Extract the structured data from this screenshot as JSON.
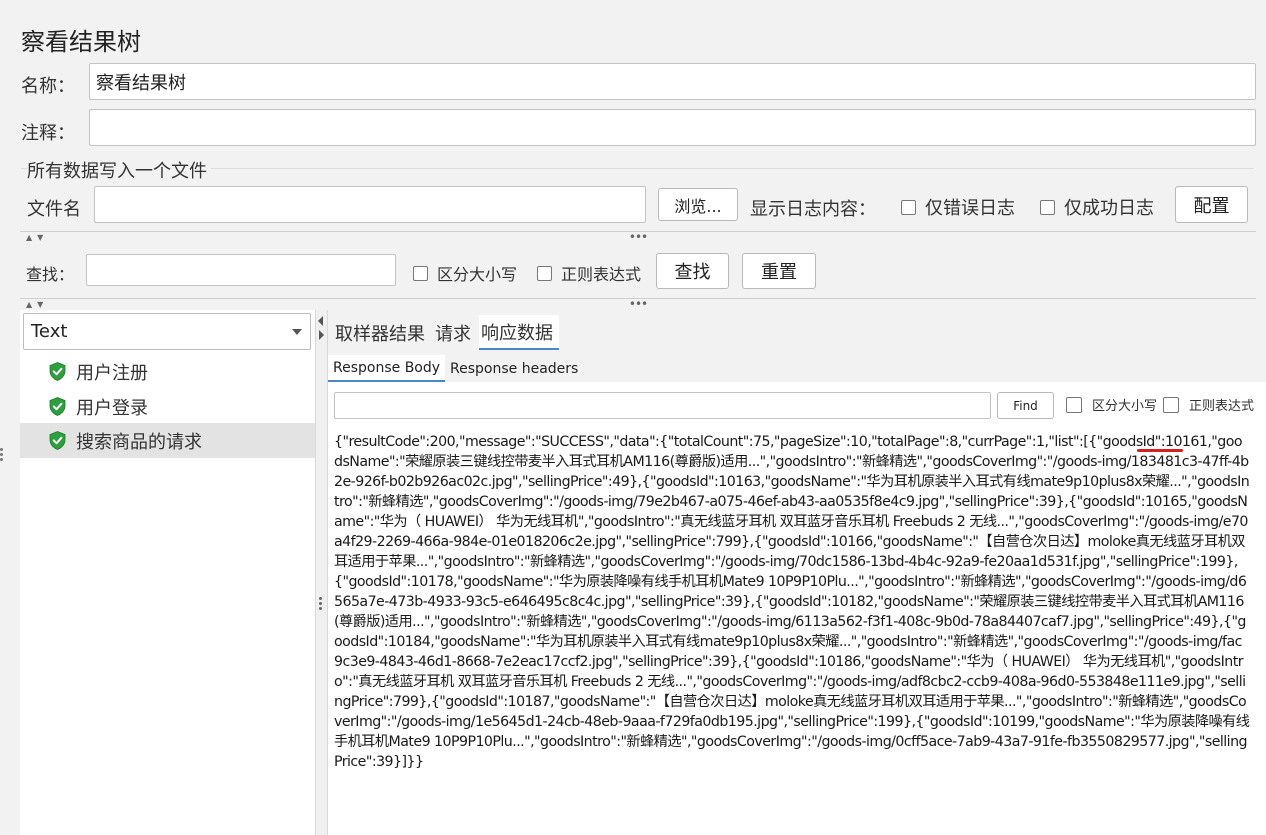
{
  "page": {
    "title": "察看结果树"
  },
  "form": {
    "name_label": "名称：",
    "name_value": "察看结果树",
    "comment_label": "注释：",
    "comment_value": ""
  },
  "file_group": {
    "title": "所有数据写入一个文件",
    "filename_label": "文件名",
    "filename_value": "",
    "browse_label": "浏览...",
    "log_label": "显示日志内容：",
    "errors_only_label": "仅错误日志",
    "success_only_label": "仅成功日志",
    "config_label": "配置"
  },
  "search": {
    "label": "查找：",
    "value": "",
    "case_label": "区分大小写",
    "regex_label": "正则表达式",
    "find_label": "查找",
    "reset_label": "重置"
  },
  "renderer": {
    "selected": "Text"
  },
  "tree": {
    "items": [
      {
        "label": "用户注册",
        "status": "success"
      },
      {
        "label": "用户登录",
        "status": "success"
      },
      {
        "label": "搜索商品的请求",
        "status": "success",
        "selected": true
      }
    ]
  },
  "result_tabs": [
    {
      "label": "取样器结果"
    },
    {
      "label": "请求"
    },
    {
      "label": "响应数据",
      "active": true
    }
  ],
  "response_tabs": [
    {
      "label": "Response Body",
      "active": true
    },
    {
      "label": "Response headers"
    }
  ],
  "response_search": {
    "value": "",
    "find_label": "Find",
    "case_label": "区分大小写",
    "regex_label": "正则表达式"
  },
  "response_body": "{\"resultCode\":200,\"message\":\"SUCCESS\",\"data\":{\"totalCount\":75,\"pageSize\":10,\"totalPage\":8,\"currPage\":1,\"list\":[{\"goodsId\":10161,\"goodsName\":\"荣耀原装三键线控带麦半入耳式耳机AM116(尊爵版)适用...\",\"goodsIntro\":\"新蜂精选\",\"goodsCoverImg\":\"/goods-img/183481c3-47ff-4b2e-926f-b02b926ac02c.jpg\",\"sellingPrice\":49},{\"goodsId\":10163,\"goodsName\":\"华为耳机原装半入耳式有线mate9p10plus8x荣耀...\",\"goodsIntro\":\"新蜂精选\",\"goodsCoverImg\":\"/goods-img/79e2b467-a075-46ef-ab43-aa0535f8e4c9.jpg\",\"sellingPrice\":39},{\"goodsId\":10165,\"goodsName\":\"华为（ HUAWEI） 华为无线耳机\",\"goodsIntro\":\"真无线蓝牙耳机 双耳蓝牙音乐耳机 Freebuds 2 无线...\",\"goodsCoverImg\":\"/goods-img/e70a4f29-2269-466a-984e-01e018206c2e.jpg\",\"sellingPrice\":799},{\"goodsId\":10166,\"goodsName\":\"【自营仓次日达】moloke真无线蓝牙耳机双耳适用于苹果...\",\"goodsIntro\":\"新蜂精选\",\"goodsCoverImg\":\"/goods-img/70dc1586-13bd-4b4c-92a9-fe20aa1d531f.jpg\",\"sellingPrice\":199},{\"goodsId\":10178,\"goodsName\":\"华为原装降噪有线手机耳机Mate9 10P9P10Plu...\",\"goodsIntro\":\"新蜂精选\",\"goodsCoverImg\":\"/goods-img/d6565a7e-473b-4933-93c5-e646495c8c4c.jpg\",\"sellingPrice\":39},{\"goodsId\":10182,\"goodsName\":\"荣耀原装三键线控带麦半入耳式耳机AM116(尊爵版)适用...\",\"goodsIntro\":\"新蜂精选\",\"goodsCoverImg\":\"/goods-img/6113a562-f3f1-408c-9b0d-78a84407caf7.jpg\",\"sellingPrice\":49},{\"goodsId\":10184,\"goodsName\":\"华为耳机原装半入耳式有线mate9p10plus8x荣耀...\",\"goodsIntro\":\"新蜂精选\",\"goodsCoverImg\":\"/goods-img/fac9c3e9-4843-46d1-8668-7e2eac17ccf2.jpg\",\"sellingPrice\":39},{\"goodsId\":10186,\"goodsName\":\"华为（ HUAWEI） 华为无线耳机\",\"goodsIntro\":\"真无线蓝牙耳机 双耳蓝牙音乐耳机 Freebuds 2 无线...\",\"goodsCoverImg\":\"/goods-img/adf8cbc2-ccb9-408a-96d0-553848e111e9.jpg\",\"sellingPrice\":799},{\"goodsId\":10187,\"goodsName\":\"【自营仓次日达】moloke真无线蓝牙耳机双耳适用于苹果...\",\"goodsIntro\":\"新蜂精选\",\"goodsCoverImg\":\"/goods-img/1e5645d1-24cb-48eb-9aaa-f729fa0db195.jpg\",\"sellingPrice\":199},{\"goodsId\":10199,\"goodsName\":\"华为原装降噪有线手机耳机Mate9 10P9P10Plu...\",\"goodsIntro\":\"新蜂精选\",\"goodsCoverImg\":\"/goods-img/0cff5ace-7ab9-43a7-91fe-fb3550829577.jpg\",\"sellingPrice\":39}]}}",
  "colors": {
    "accent": "#4a88c7",
    "highlight_underline": "#d42020",
    "success_icon": "#2e9e3e"
  }
}
